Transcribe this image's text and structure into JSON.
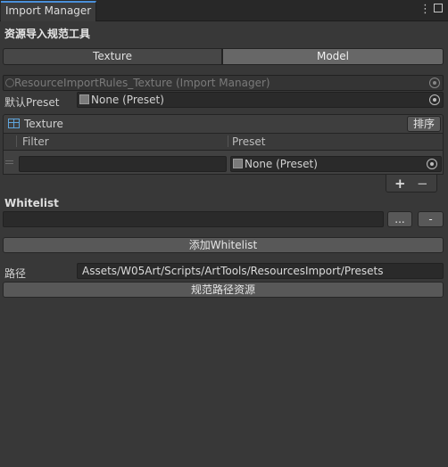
{
  "window": {
    "tab_title": "Import Manager",
    "menu_icon": "kebab-menu-icon",
    "maximize_icon": "maximize-icon"
  },
  "header": {
    "title": "资源导入规范工具"
  },
  "toggle": {
    "texture_label": "Texture",
    "model_label": "Model",
    "selected": "Model"
  },
  "script_field": {
    "value": "ResourceImportRules_Texture (Import Manager)"
  },
  "default_preset": {
    "label": "默认Preset",
    "value": "None (Preset)"
  },
  "list": {
    "title": "Texture",
    "sort_button": "排序",
    "columns": [
      "Filter",
      "Preset"
    ],
    "rows": [
      {
        "filter": "",
        "preset": "None (Preset)"
      }
    ],
    "add_label": "+",
    "remove_label": "−"
  },
  "whitelist": {
    "label": "Whitelist",
    "value": "",
    "browse_label": "...",
    "remove_label": "-",
    "add_button": "添加Whitelist"
  },
  "path": {
    "label": "路径",
    "value": "Assets/W05Art/Scripts/ArtTools/ResourcesImport/Presets",
    "apply_button": "规范路径资源"
  },
  "colors": {
    "background": "#383838",
    "field": "#2a2a2a",
    "button": "#585858",
    "tab_accent": "#4a8fd9"
  }
}
